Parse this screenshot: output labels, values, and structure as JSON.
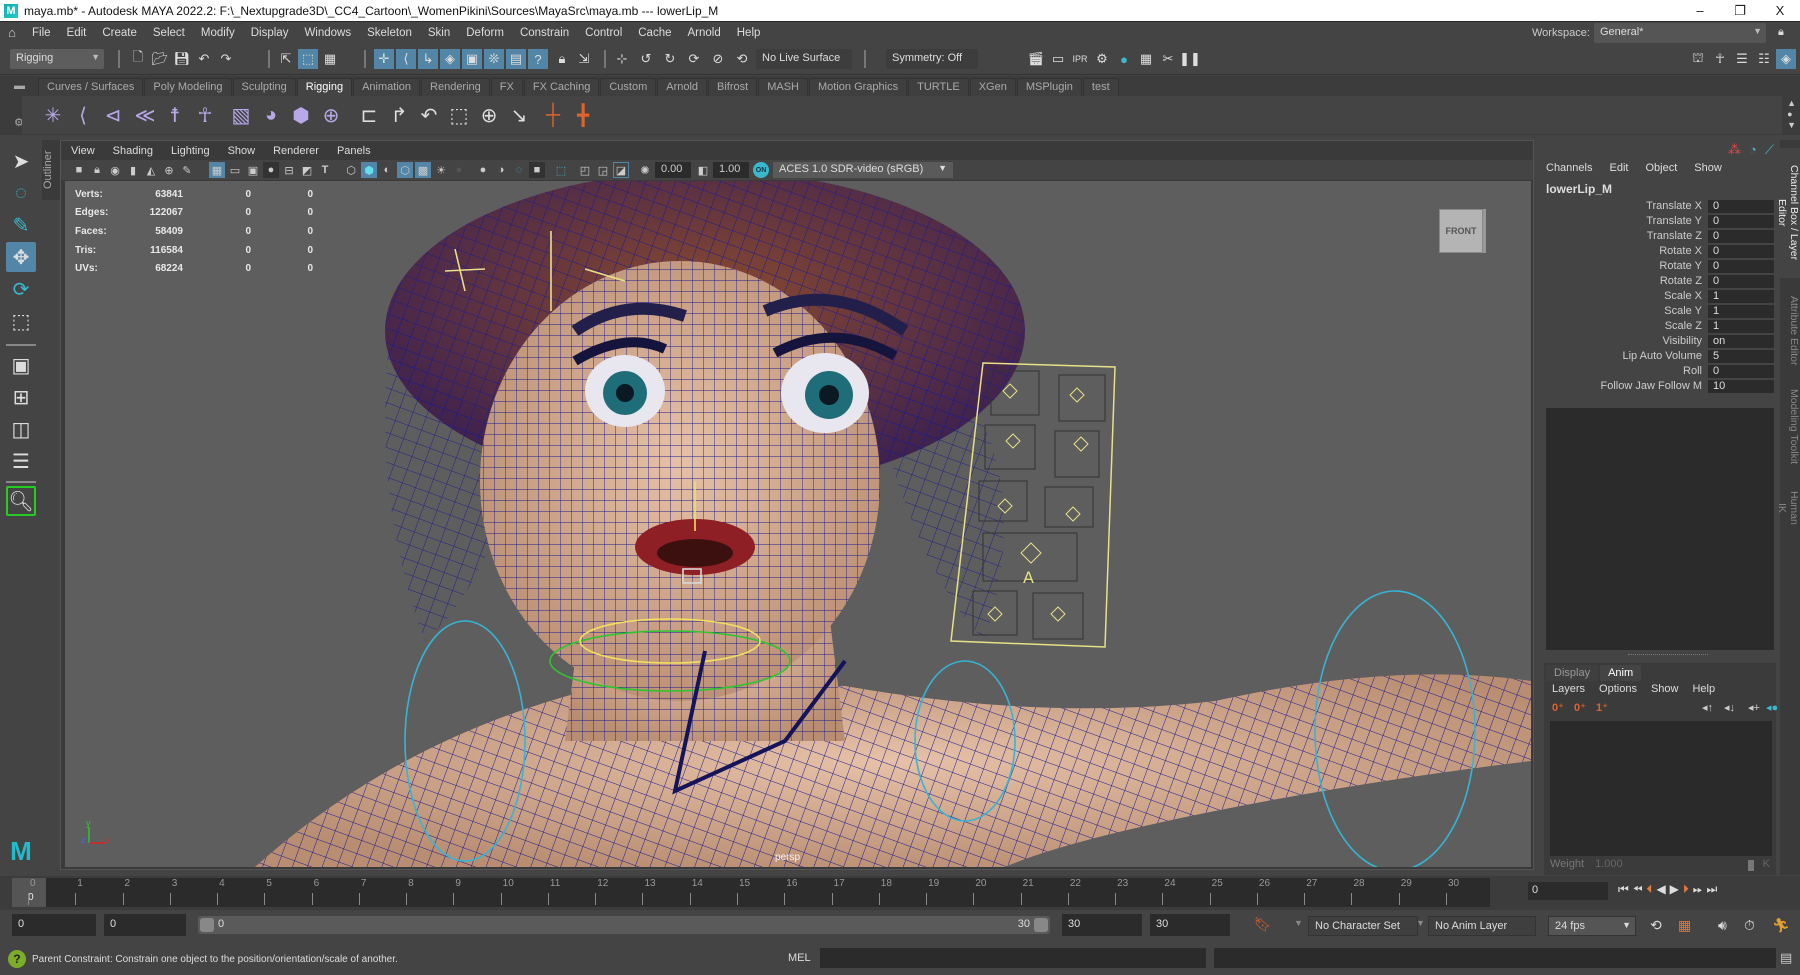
{
  "window": {
    "title": "maya.mb* - Autodesk MAYA 2022.2: F:\\_Nextupgrade3D\\_CC4_Cartoon\\_WomenPikini\\Sources\\MayaSrc\\maya.mb   ---   lowerLip_M",
    "controls": {
      "minimize": "–",
      "restore": "❐",
      "close": "X"
    }
  },
  "menubar": {
    "items": [
      "File",
      "Edit",
      "Create",
      "Select",
      "Modify",
      "Display",
      "Windows",
      "Skeleton",
      "Skin",
      "Deform",
      "Constrain",
      "Control",
      "Cache",
      "Arnold",
      "Help"
    ],
    "workspace_label": "Workspace:",
    "workspace_value": "General*"
  },
  "statusline": {
    "menuset": "Rigging",
    "live_surface": "No Live Surface",
    "symmetry": "Symmetry: Off"
  },
  "shelf": {
    "tabs": [
      "Curves / Surfaces",
      "Poly Modeling",
      "Sculpting",
      "Rigging",
      "Animation",
      "Rendering",
      "FX",
      "FX Caching",
      "Custom",
      "Arnold",
      "Bifrost",
      "MASH",
      "Motion Graphics",
      "TURTLE",
      "XGen",
      "MSPlugin",
      "test"
    ],
    "active_tab": "Rigging",
    "icons": [
      "create-joints-icon",
      "insert-joint-icon",
      "mirror-joint-icon",
      "ik-handle-icon",
      "quick-rig-icon",
      "humanik-icon",
      "bind-skin-icon",
      "paint-weights-icon",
      "lattice-icon",
      "cluster-icon",
      "parent-constraint-icon",
      "point-constraint-icon",
      "orient-constraint-icon",
      "scale-constraint-icon",
      "aim-constraint-icon",
      "pole-vector-icon",
      "add-influence-icon",
      "remove-influence-icon"
    ]
  },
  "outliner_tab": "Outliner",
  "panel": {
    "menus": [
      "View",
      "Shading",
      "Lighting",
      "Show",
      "Renderer",
      "Panels"
    ],
    "exposure": "0.00",
    "gamma": "1.00",
    "color_management_on": "ON",
    "color_space": "ACES 1.0 SDR-video (sRGB)"
  },
  "hud": {
    "rows": [
      {
        "label": "Verts:",
        "v1": "63841",
        "v2": "0",
        "v3": "0"
      },
      {
        "label": "Edges:",
        "v1": "122067",
        "v2": "0",
        "v3": "0"
      },
      {
        "label": "Faces:",
        "v1": "58409",
        "v2": "0",
        "v3": "0"
      },
      {
        "label": "Tris:",
        "v1": "116584",
        "v2": "0",
        "v3": "0"
      },
      {
        "label": "UVs:",
        "v1": "68224",
        "v2": "0",
        "v3": "0"
      }
    ]
  },
  "viewport": {
    "viewcube": "FRONT",
    "camera": "persp",
    "axis": {
      "y": "y",
      "z": "z",
      "x": "x"
    }
  },
  "channelbox": {
    "menus": [
      "Channels",
      "Edit",
      "Object",
      "Show"
    ],
    "object": "lowerLip_M",
    "channels": [
      {
        "label": "Translate X",
        "value": "0"
      },
      {
        "label": "Translate Y",
        "value": "0"
      },
      {
        "label": "Translate Z",
        "value": "0"
      },
      {
        "label": "Rotate X",
        "value": "0"
      },
      {
        "label": "Rotate Y",
        "value": "0"
      },
      {
        "label": "Rotate Z",
        "value": "0"
      },
      {
        "label": "Scale X",
        "value": "1"
      },
      {
        "label": "Scale Y",
        "value": "1"
      },
      {
        "label": "Scale Z",
        "value": "1"
      },
      {
        "label": "Visibility",
        "value": "on"
      },
      {
        "label": "Lip Auto Volume",
        "value": "5"
      },
      {
        "label": "Roll",
        "value": "0"
      },
      {
        "label": "Follow Jaw Follow M",
        "value": "10"
      }
    ]
  },
  "layer_editor": {
    "tabs": [
      "Display",
      "Anim"
    ],
    "active_tab": "Anim",
    "menus": [
      "Layers",
      "Options",
      "Show",
      "Help"
    ],
    "weight_label": "Weight",
    "weight_value": "1.000",
    "key_label": "K"
  },
  "side_tabs": [
    "Channel Box / Layer Editor",
    "Attribute Editor",
    "Modeling Toolkit",
    "Human IK"
  ],
  "timeslider": {
    "start": 0,
    "end": 30,
    "current_frame": "0",
    "current_time_field": "0"
  },
  "rangeslider": {
    "anim_start": "0",
    "playback_start": "0",
    "range_start_label": "0",
    "range_end_label": "30",
    "playback_end": "30",
    "anim_end": "30",
    "character_set": "No Character Set",
    "anim_layer": "No Anim Layer",
    "fps": "24 fps"
  },
  "commandline": {
    "help_text": "Parent Constraint: Constrain one object to the position/orientation/scale of another.",
    "mel_label": "MEL"
  },
  "colors": {
    "accent_blue": "#5285a6",
    "shelf_icon": "#b8a8e8",
    "orange": "#e0632b",
    "help_green": "#7cad2a",
    "wire": "#1c1c8c",
    "skin": "#d9b49a"
  }
}
